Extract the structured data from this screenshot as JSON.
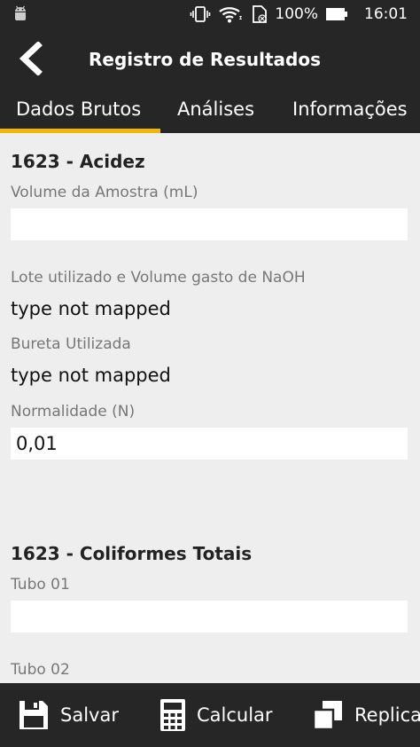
{
  "status_bar": {
    "battery": "100%",
    "time": "16:01",
    "icons": [
      "android-icon",
      "vibrate-icon",
      "wifi-icon",
      "sim-icon",
      "battery-icon"
    ]
  },
  "app_bar": {
    "title": "Registro de Resultados",
    "back_icon": "chevron-left-icon"
  },
  "tabs": [
    {
      "label": "Dados Brutos",
      "active": true
    },
    {
      "label": "Análises",
      "active": false
    },
    {
      "label": "Informações",
      "active": false
    }
  ],
  "colors": {
    "bar": "#262626",
    "accent": "#f5b800",
    "background": "#eeeeee"
  },
  "sections": [
    {
      "title": "1623 - Acidez",
      "fields": [
        {
          "label": "Volume da Amostra (mL)",
          "value": ""
        },
        {
          "label": "Lote utilizado e Volume gasto de NaOH",
          "text": "type not mapped"
        },
        {
          "label": "Bureta Utilizada",
          "text": "type not mapped"
        },
        {
          "label": "Normalidade (N)",
          "value": "0,01"
        }
      ]
    },
    {
      "title": "1623 - Coliformes Totais",
      "fields": [
        {
          "label": "Tubo 01",
          "value": ""
        },
        {
          "label": "Tubo 02",
          "value": ""
        }
      ]
    }
  ],
  "bottom_bar": {
    "save": "Salvar",
    "calculate": "Calcular",
    "replicate": "Replicar"
  }
}
